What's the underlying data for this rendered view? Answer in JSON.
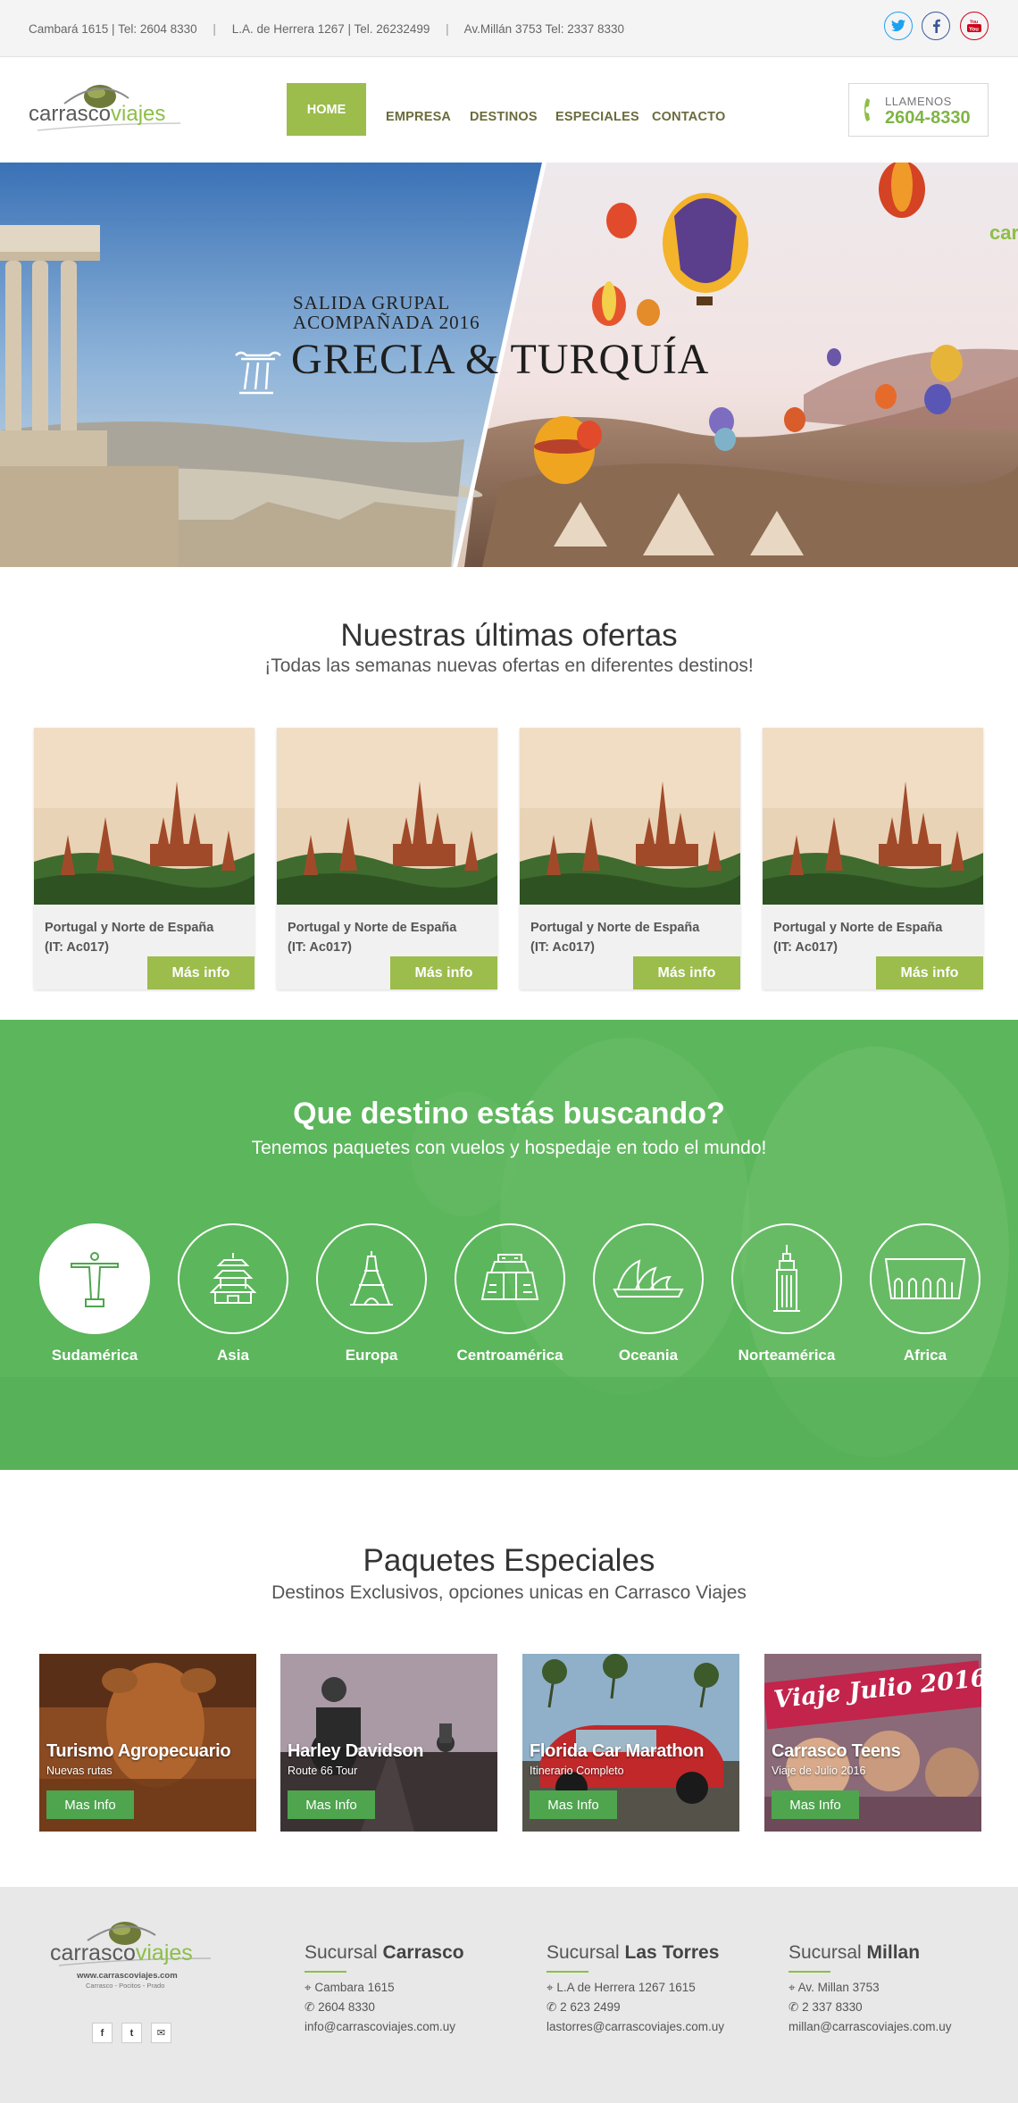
{
  "topbar": {
    "contacts": [
      "Cambará 1615 | Tel: 2604 8330",
      "L.A. de Herrera 1267 | Tel. 26232499",
      "Av.Millán 3753 Tel: 2337 8330"
    ],
    "separator": "|",
    "social": [
      {
        "name": "twitter-icon",
        "glyph": "t",
        "color": "#1da1f2"
      },
      {
        "name": "facebook-icon",
        "glyph": "f",
        "color": "#3b5998"
      },
      {
        "name": "youtube-icon",
        "glyph": "▶",
        "color": "#d0021b"
      }
    ]
  },
  "header": {
    "logo": {
      "part1": "carrasco",
      "part2": "viajes"
    },
    "nav": [
      "HOME",
      "EMPRESA",
      "DESTINOS",
      "ESPECIALES",
      "CONTACTO"
    ],
    "call_label": "LLAMENOS",
    "call_number": "2604-8330"
  },
  "hero": {
    "subtitle_1": "SALIDA GRUPAL",
    "subtitle_2": "ACOMPAÑADA 2016",
    "title": "GRECIA & TURQUÍA",
    "corner_text": "car"
  },
  "offers": {
    "title": "Nuestras últimas ofertas",
    "subtitle": "¡Todas las semanas nuevas ofertas en diferentes destinos!",
    "items": [
      {
        "line1": "Portugal y Norte de España",
        "line2": "(IT: Ac017)",
        "button": "Más info"
      },
      {
        "line1": "Portugal y Norte de España",
        "line2": "(IT: Ac017)",
        "button": "Más info"
      },
      {
        "line1": "Portugal y Norte de España",
        "line2": "(IT: Ac017)",
        "button": "Más info"
      },
      {
        "line1": "Portugal y Norte de España",
        "line2": "(IT: Ac017)",
        "button": "Más info"
      }
    ]
  },
  "destinations": {
    "title": "Que destino estás buscando?",
    "subtitle": "Tenemos paquetes con vuelos y hospedaje en todo el mundo!",
    "items": [
      {
        "label": "Sudamérica",
        "icon": "christ-redeemer-icon"
      },
      {
        "label": "Asia",
        "icon": "temple-of-heaven-icon"
      },
      {
        "label": "Europa",
        "icon": "eiffel-tower-icon"
      },
      {
        "label": "Centroamérica",
        "icon": "pyramid-icon"
      },
      {
        "label": "Oceania",
        "icon": "opera-house-icon"
      },
      {
        "label": "Norteamérica",
        "icon": "empire-state-icon"
      },
      {
        "label": "Africa",
        "icon": "museum-icon"
      }
    ]
  },
  "specials": {
    "title": "Paquetes Especiales",
    "subtitle": "Destinos Exclusivos, opciones unicas en Carrasco Viajes",
    "items": [
      {
        "title": "Turismo Agropecuario",
        "sub": "Nuevas rutas",
        "button": "Mas Info"
      },
      {
        "title": "Harley Davidson",
        "sub": "Route 66 Tour",
        "button": "Mas Info"
      },
      {
        "title": "Florida Car Marathon",
        "sub": "Itinerario Completo",
        "button": "Mas Info"
      },
      {
        "title": "Carrasco Teens",
        "sub": "Viaje de Julio 2016",
        "button": "Mas Info",
        "banner": "Viaje Julio 2016"
      }
    ]
  },
  "footer": {
    "logo_url": "www.carrascoviajes.com",
    "logo_tag": "Carrasco - Pocitos - Prado",
    "branch_word": "Sucursal",
    "branches": [
      {
        "name": "Carrasco",
        "address": "Cambara 1615",
        "phone": "2604 8330",
        "email": "info@carrascoviajes.com.uy"
      },
      {
        "name": "Las Torres",
        "address": "L.A de Herrera 1267 1615",
        "phone": "2 623 2499",
        "email": "lastorres@carrascoviajes.com.uy"
      },
      {
        "name": "Millan",
        "address": "Av. Millan 3753",
        "phone": "2 337 8330",
        "email": "millan@carrascoviajes.com.uy"
      }
    ]
  },
  "colors": {
    "accent": "#9cbc4c",
    "green_section": "#5cb65c",
    "button_green": "#4ea54e"
  }
}
